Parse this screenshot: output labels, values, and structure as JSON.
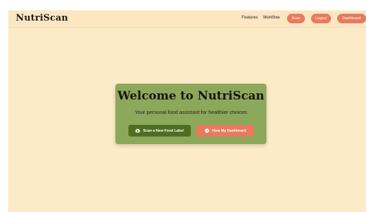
{
  "navbar": {
    "brand": "NutriScan",
    "links": {
      "features": "Features",
      "workflow": "Workflow"
    },
    "buttons": {
      "scan": "Scan",
      "logout": "Logout",
      "dashboard": "Dashboard"
    }
  },
  "hero": {
    "title": "Welcome to NutriScan",
    "subtitle": "Your personal food assistant for healthier choices",
    "primary_button": {
      "label": "Scan a New Food Label",
      "icon": "camera-icon"
    },
    "secondary_button": {
      "label": "View My Dashboard",
      "icon": "gauge-icon"
    }
  },
  "colors": {
    "background": "#fdeac7",
    "accent": "#e87a5e",
    "card": "#8ca85a",
    "primary_button": "#4f6e22"
  }
}
